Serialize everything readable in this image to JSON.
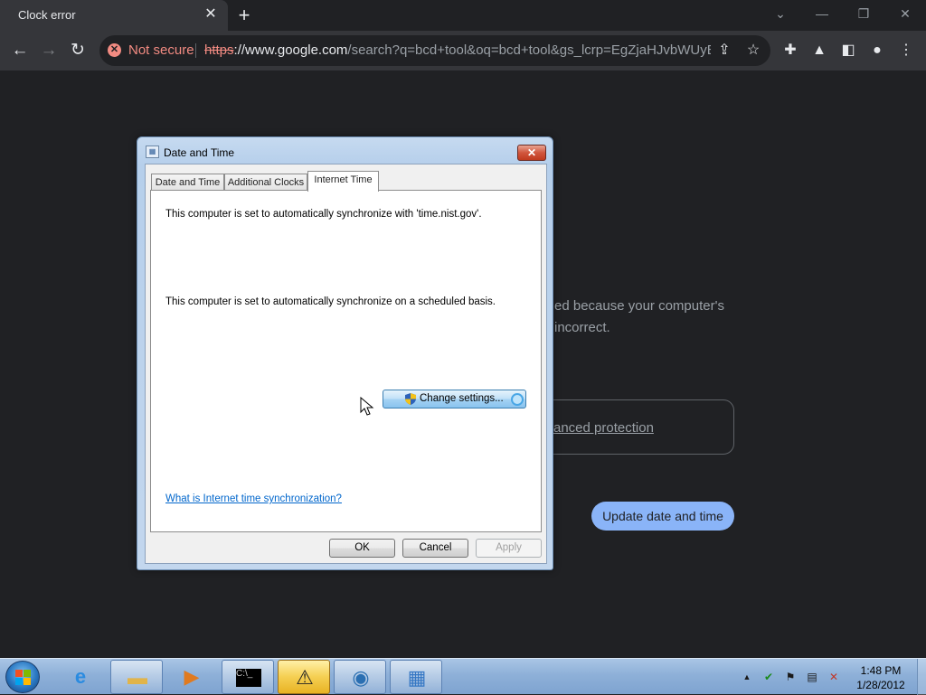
{
  "browser": {
    "tab_title": "Clock error",
    "tab_close": "✕",
    "new_tab": "+",
    "security_label": "Not secure",
    "url_scheme": "https",
    "url_host": "://www.google.com",
    "url_rest": "/search?q=bcd+tool&oq=bcd+tool&gs_lcrp=EgZjaHJvbWUyBg..."
  },
  "error_page": {
    "body_line1": "ed because your computer's",
    "body_line2": "incorrect.",
    "enhanced_link": "anced protection",
    "update_button": "Update date and time"
  },
  "dialog": {
    "title": "Date and Time",
    "tabs": [
      {
        "label": "Date and Time"
      },
      {
        "label": "Additional Clocks"
      },
      {
        "label": "Internet Time"
      }
    ],
    "sync_server_text": "This computer is set to automatically synchronize with 'time.nist.gov'.",
    "schedule_text": "This computer is set to automatically synchronize on a scheduled basis.",
    "change_settings": "Change settings...",
    "help_link": "What is Internet time synchronization?",
    "ok": "OK",
    "cancel": "Cancel",
    "apply": "Apply"
  },
  "taskbar": {
    "clock_time": "1:48 PM",
    "clock_date": "1/28/2012",
    "tray_expand": "▲",
    "accent": "#8eb0d8"
  },
  "colors": {
    "chrome_bg": "#202124",
    "toolbar_bg": "#35363a",
    "not_secure": "#f28b82",
    "update_button": "#8ab4f8"
  }
}
